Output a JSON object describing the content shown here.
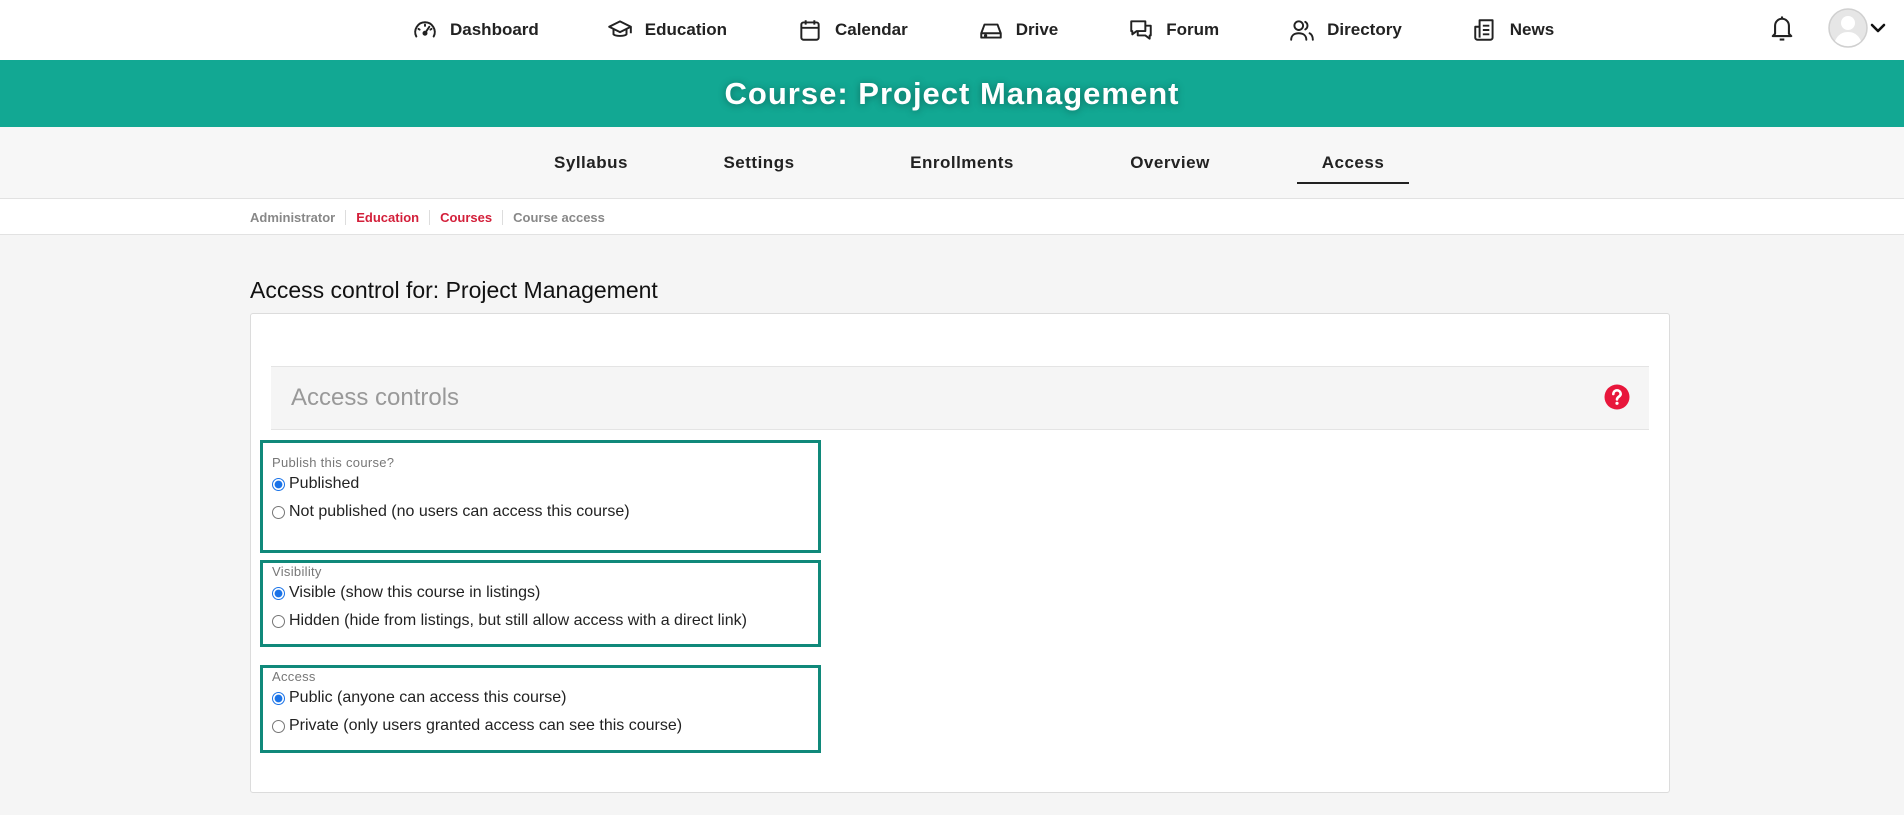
{
  "nav": {
    "items": [
      {
        "label": "Dashboard",
        "icon": "dashboard-gauge-icon"
      },
      {
        "label": "Education",
        "icon": "graduation-cap-icon"
      },
      {
        "label": "Calendar",
        "icon": "calendar-icon"
      },
      {
        "label": "Drive",
        "icon": "drive-icon"
      },
      {
        "label": "Forum",
        "icon": "chat-bubbles-icon"
      },
      {
        "label": "Directory",
        "icon": "users-icon"
      },
      {
        "label": "News",
        "icon": "newspaper-icon"
      }
    ],
    "notifications_icon": "bell-icon",
    "avatar_icon": "user-avatar-icon",
    "menu_icon": "chevron-down-icon"
  },
  "banner": {
    "title": "Course: Project Management",
    "color": "#12a893"
  },
  "tabs": [
    {
      "label": "Syllabus",
      "active": false
    },
    {
      "label": "Settings",
      "active": false
    },
    {
      "label": "Enrollments",
      "active": false
    },
    {
      "label": "Overview",
      "active": false
    },
    {
      "label": "Access",
      "active": true
    }
  ],
  "breadcrumb": [
    {
      "label": "Administrator",
      "link": false
    },
    {
      "label": "Education",
      "link": true
    },
    {
      "label": "Courses",
      "link": true
    },
    {
      "label": "Course access",
      "link": false
    }
  ],
  "page": {
    "title": "Access control for: Project Management"
  },
  "section": {
    "title": "Access controls",
    "help_icon": "question-circle-icon"
  },
  "groups": [
    {
      "legend": "Publish this course?",
      "options": [
        {
          "label": "Published",
          "checked": true
        },
        {
          "label": "Not published (no users can access this course)",
          "checked": false
        }
      ]
    },
    {
      "legend": "Visibility",
      "options": [
        {
          "label": "Visible (show this course in listings)",
          "checked": true
        },
        {
          "label": "Hidden (hide from listings, but still allow access with a direct link)",
          "checked": false
        }
      ]
    },
    {
      "legend": "Access",
      "options": [
        {
          "label": "Public (anyone can access this course)",
          "checked": true
        },
        {
          "label": "Private (only users granted access can see this course)",
          "checked": false
        }
      ]
    }
  ],
  "colors": {
    "accent_teal": "#12a893",
    "highlight_border": "#10897a",
    "link_red": "#d31f3a",
    "help_red": "#e8163b"
  }
}
